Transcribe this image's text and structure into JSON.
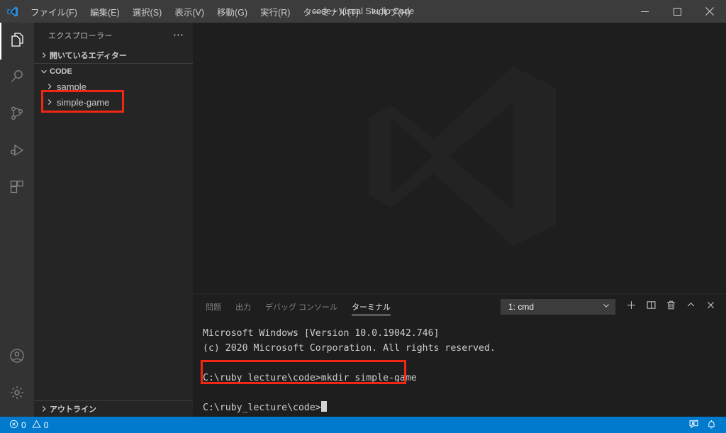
{
  "titlebar": {
    "logo_icon": "vscode-logo-icon",
    "window_title": "code - Visual Studio Code",
    "menus": [
      {
        "label": "ファイル(F)",
        "name": "menu-file"
      },
      {
        "label": "編集(E)",
        "name": "menu-edit"
      },
      {
        "label": "選択(S)",
        "name": "menu-selection"
      },
      {
        "label": "表示(V)",
        "name": "menu-view"
      },
      {
        "label": "移動(G)",
        "name": "menu-go"
      },
      {
        "label": "実行(R)",
        "name": "menu-run"
      },
      {
        "label": "ターミナル(T)",
        "name": "menu-terminal"
      },
      {
        "label": "ヘルプ(H)",
        "name": "menu-help"
      }
    ],
    "controls": {
      "minimize": "—",
      "maximize": "▢",
      "close": "✕"
    }
  },
  "activitybar": {
    "items": [
      {
        "icon": "explorer-files-icon",
        "active": true
      },
      {
        "icon": "search-icon",
        "active": false
      },
      {
        "icon": "source-control-icon",
        "active": false
      },
      {
        "icon": "run-and-debug-icon",
        "active": false
      },
      {
        "icon": "extensions-icon",
        "active": false
      }
    ],
    "bottom_items": [
      {
        "icon": "account-icon"
      },
      {
        "icon": "settings-gear-icon"
      }
    ]
  },
  "sidebar": {
    "title": "エクスプローラー",
    "actions_icon": "more-actions-icon",
    "sections": [
      {
        "label": "開いているエディター",
        "expanded": false
      },
      {
        "label": "CODE",
        "expanded": true
      }
    ],
    "tree": [
      {
        "label": "sample",
        "expanded": false,
        "highlighted": false
      },
      {
        "label": "simple-game",
        "expanded": false,
        "highlighted": true
      }
    ],
    "outline": {
      "label": "アウトライン",
      "expanded": false
    },
    "highlight_color": "#f22613"
  },
  "editor": {
    "watermark_icon": "vscode-logo-watermark"
  },
  "panel": {
    "tabs": [
      {
        "label": "問題",
        "active": false
      },
      {
        "label": "出力",
        "active": false
      },
      {
        "label": "デバッグ コンソール",
        "active": false
      },
      {
        "label": "ターミナル",
        "active": true
      }
    ],
    "terminal_select": {
      "value": "1: cmd",
      "chevron_icon": "chevron-down-icon"
    },
    "actions": [
      {
        "icon": "new-terminal-plus-icon"
      },
      {
        "icon": "split-terminal-icon"
      },
      {
        "icon": "kill-terminal-trash-icon"
      },
      {
        "icon": "maximize-panel-chevron-up-icon"
      },
      {
        "icon": "close-panel-icon"
      }
    ]
  },
  "terminal": {
    "lines": [
      "Microsoft Windows [Version 10.0.19042.746]",
      "(c) 2020 Microsoft Corporation. All rights reserved.",
      "",
      "C:\\ruby_lecture\\code>mkdir simple-game",
      "",
      "C:\\ruby_lecture\\code>"
    ],
    "highlighted_line_index": 3,
    "highlight_color": "#f22613",
    "cursor": "block"
  },
  "statusbar": {
    "background": "#007acc",
    "errors": {
      "icon": "error-circle-icon",
      "count": "0"
    },
    "warnings": {
      "icon": "warning-triangle-icon",
      "count": "0"
    },
    "right_items": [
      {
        "icon": "feedback-tweet-icon"
      },
      {
        "icon": "notifications-bell-icon"
      }
    ]
  },
  "colors": {
    "titlebar_bg": "#3c3c3c",
    "activitybar_bg": "#333333",
    "sidebar_bg": "#252526",
    "editor_bg": "#1e1e1e",
    "accent": "#007acc",
    "highlight_red": "#f22613"
  }
}
